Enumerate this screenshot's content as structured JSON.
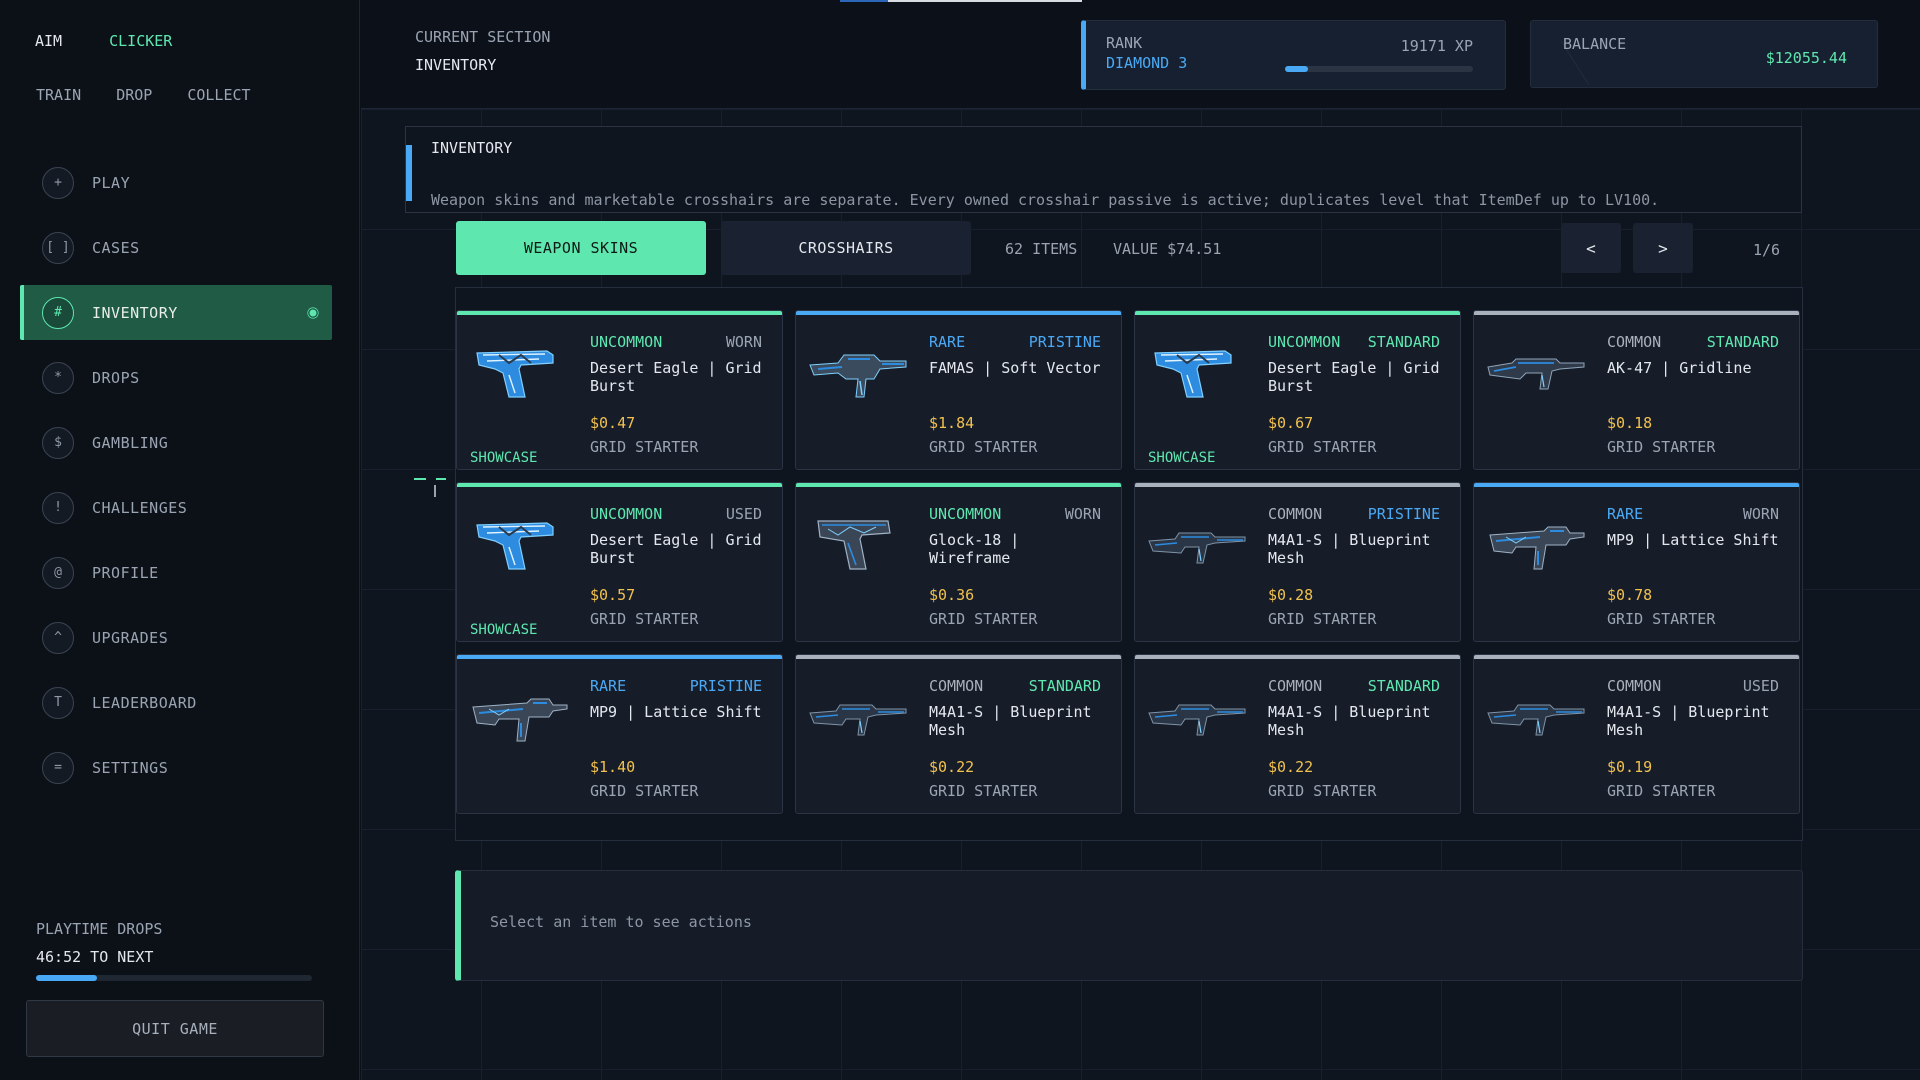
{
  "brand": {
    "part1": "AIM",
    "part2": "CLICKER"
  },
  "topnav": [
    "TRAIN",
    "DROP",
    "COLLECT"
  ],
  "menu": [
    {
      "icon": "+",
      "label": "PLAY",
      "icon_name": "plus-icon"
    },
    {
      "icon": "[ ]",
      "label": "CASES",
      "icon_name": "brackets-icon"
    },
    {
      "icon": "#",
      "label": "INVENTORY",
      "icon_name": "hash-icon",
      "active": true
    },
    {
      "icon": "*",
      "label": "DROPS",
      "icon_name": "star-icon"
    },
    {
      "icon": "$",
      "label": "GAMBLING",
      "icon_name": "dollar-icon"
    },
    {
      "icon": "!",
      "label": "CHALLENGES",
      "icon_name": "exclamation-icon"
    },
    {
      "icon": "@",
      "label": "PROFILE",
      "icon_name": "at-icon"
    },
    {
      "icon": "^",
      "label": "UPGRADES",
      "icon_name": "caret-icon"
    },
    {
      "icon": "T",
      "label": "LEADERBOARD",
      "icon_name": "trophy-icon"
    },
    {
      "icon": "=",
      "label": "SETTINGS",
      "icon_name": "settings-icon"
    }
  ],
  "playtime": {
    "label": "PLAYTIME DROPS",
    "next": "46:52 TO NEXT",
    "progress": 0.22
  },
  "quit_label": "QUIT GAME",
  "current_section": {
    "label": "CURRENT SECTION",
    "value": "INVENTORY"
  },
  "rank": {
    "label": "RANK",
    "value": "DIAMOND 3",
    "xp": "19171 XP",
    "progress": 0.12
  },
  "balance": {
    "label": "BALANCE",
    "value": "$12055.44"
  },
  "info": {
    "title": "INVENTORY",
    "desc": "Weapon skins and marketable crosshairs are separate. Every owned crosshair passive is active; duplicates level that ItemDef up to LV100."
  },
  "tabs": {
    "skins": "WEAPON SKINS",
    "crosshairs": "CROSSHAIRS"
  },
  "summary": {
    "items": "62 ITEMS",
    "value": "VALUE $74.51"
  },
  "pager": {
    "prev": "<",
    "next": ">",
    "page": "1/6"
  },
  "colors": {
    "uncommon": "#5ee8b0",
    "rare": "#4aa9f5",
    "common": "#a9b1bd",
    "pristine": "#4aa9f5",
    "standard": "#5ee8b0",
    "worn": "#9aa4b2",
    "used": "#9aa4b2",
    "price": "#f2c14e"
  },
  "items": [
    {
      "rarity": "UNCOMMON",
      "wear": "WORN",
      "name": "Desert Eagle | Grid Burst",
      "price": "$0.47",
      "collection": "GRID STARTER",
      "showcase": "SHOWCASE",
      "weapon": "pistol"
    },
    {
      "rarity": "RARE",
      "wear": "PRISTINE",
      "name": "FAMAS | Soft Vector",
      "price": "$1.84",
      "collection": "GRID STARTER",
      "showcase": "",
      "weapon": "famas"
    },
    {
      "rarity": "UNCOMMON",
      "wear": "STANDARD",
      "name": "Desert Eagle | Grid Burst",
      "price": "$0.67",
      "collection": "GRID STARTER",
      "showcase": "SHOWCASE",
      "weapon": "pistol"
    },
    {
      "rarity": "COMMON",
      "wear": "STANDARD",
      "name": "AK-47 | Gridline",
      "price": "$0.18",
      "collection": "GRID STARTER",
      "showcase": "",
      "weapon": "rifle"
    },
    {
      "rarity": "UNCOMMON",
      "wear": "USED",
      "name": "Desert Eagle | Grid Burst",
      "price": "$0.57",
      "collection": "GRID STARTER",
      "showcase": "SHOWCASE",
      "weapon": "pistol"
    },
    {
      "rarity": "UNCOMMON",
      "wear": "WORN",
      "name": "Glock-18 | Wireframe",
      "price": "$0.36",
      "collection": "GRID STARTER",
      "showcase": "",
      "weapon": "glock"
    },
    {
      "rarity": "COMMON",
      "wear": "PRISTINE",
      "name": "M4A1-S | Blueprint Mesh",
      "price": "$0.28",
      "collection": "GRID STARTER",
      "showcase": "",
      "weapon": "m4"
    },
    {
      "rarity": "RARE",
      "wear": "WORN",
      "name": "MP9 | Lattice Shift",
      "price": "$0.78",
      "collection": "GRID STARTER",
      "showcase": "",
      "weapon": "smg"
    },
    {
      "rarity": "RARE",
      "wear": "PRISTINE",
      "name": "MP9 | Lattice Shift",
      "price": "$1.40",
      "collection": "GRID STARTER",
      "showcase": "",
      "weapon": "smg"
    },
    {
      "rarity": "COMMON",
      "wear": "STANDARD",
      "name": "M4A1-S | Blueprint Mesh",
      "price": "$0.22",
      "collection": "GRID STARTER",
      "showcase": "",
      "weapon": "m4"
    },
    {
      "rarity": "COMMON",
      "wear": "STANDARD",
      "name": "M4A1-S | Blueprint Mesh",
      "price": "$0.22",
      "collection": "GRID STARTER",
      "showcase": "",
      "weapon": "m4"
    },
    {
      "rarity": "COMMON",
      "wear": "USED",
      "name": "M4A1-S | Blueprint Mesh",
      "price": "$0.19",
      "collection": "GRID STARTER",
      "showcase": "",
      "weapon": "m4"
    }
  ],
  "select_hint": "Select an item to see actions"
}
